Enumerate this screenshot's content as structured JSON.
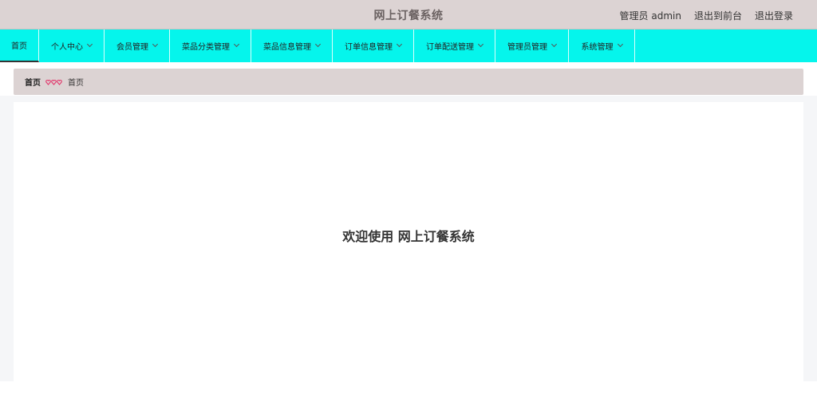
{
  "header": {
    "title": "网上订餐系统",
    "user": "管理员 admin",
    "to_front": "退出到前台",
    "logout": "退出登录"
  },
  "nav": {
    "items": [
      {
        "label": "首页"
      },
      {
        "label": "个人中心"
      },
      {
        "label": "会员管理"
      },
      {
        "label": "菜品分类管理"
      },
      {
        "label": "菜品信息管理"
      },
      {
        "label": "订单信息管理"
      },
      {
        "label": "订单配送管理"
      },
      {
        "label": "管理员管理"
      },
      {
        "label": "系统管理"
      }
    ]
  },
  "breadcrumb": {
    "home": "首页",
    "current": "首页",
    "separator_icon": "triple-heart-icon"
  },
  "main": {
    "welcome": "欢迎使用 网上订餐系统"
  },
  "colors": {
    "header_bg": "#dcd3d3",
    "nav_bg": "#05f5ec",
    "separator_icon": "#e2396d"
  }
}
